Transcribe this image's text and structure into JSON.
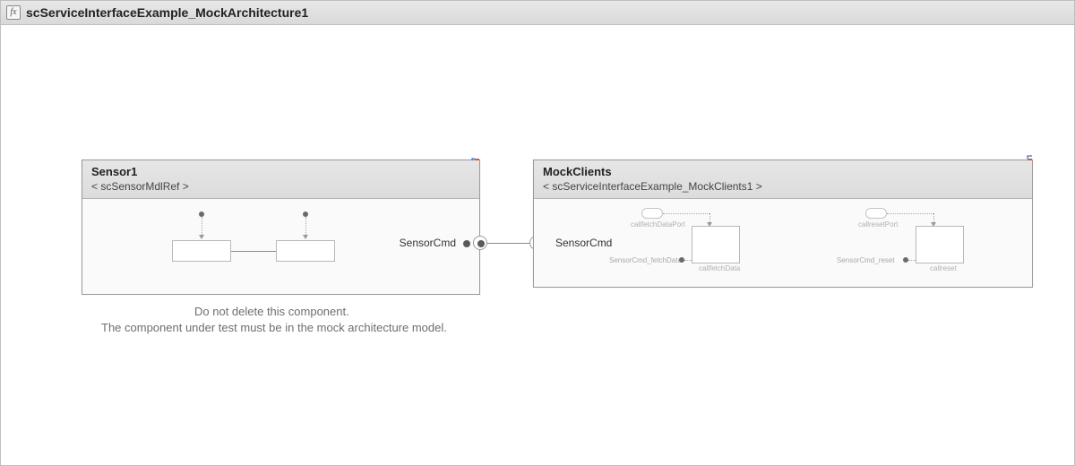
{
  "window": {
    "title": "scServiceInterfaceExample_MockArchitecture1"
  },
  "sensor1": {
    "name": "Sensor1",
    "ref": "< scSensorMdlRef >",
    "port_out_label": "SensorCmd"
  },
  "mockclients": {
    "name": "MockClients",
    "ref": "< scServiceInterfaceExample_MockClients1 >",
    "port_in_label": "SensorCmd",
    "sub1": {
      "top_label": "callfetchDataPort",
      "bottom_label": "callfetchData",
      "left_label": "SensorCmd_fetchData"
    },
    "sub2": {
      "top_label": "callresetPort",
      "bottom_label": "callreset",
      "left_label": "SensorCmd_reset"
    }
  },
  "caption": {
    "line1": "Do not delete this component.",
    "line2": "The component under test must be in the mock architecture model."
  }
}
